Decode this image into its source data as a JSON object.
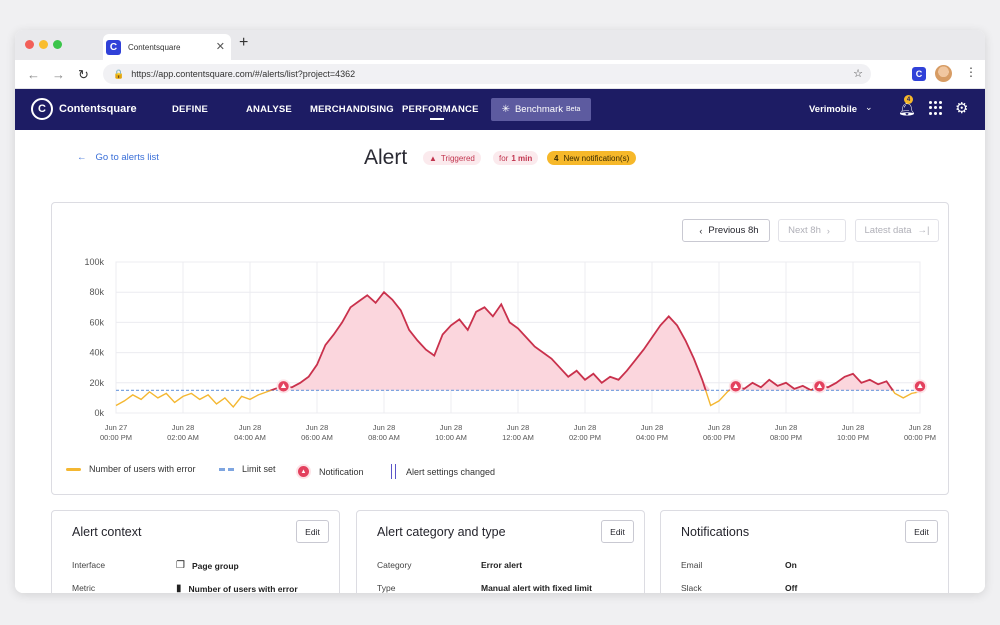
{
  "browser": {
    "tab_title": "Contentsquare",
    "tab_icon": "contentsquare-logo",
    "url": "https://app.contentsquare.com/#/alerts/list?project=4362"
  },
  "nav": {
    "logo": "Contentsquare",
    "items": [
      "DEFINE",
      "ANALYSE",
      "MERCHANDISING",
      "PERFORMANCE"
    ],
    "active": "PERFORMANCE",
    "benchmark_label": "Benchmark",
    "benchmark_badge": "Beta",
    "account": "Verimobile",
    "notification_count": "4"
  },
  "header": {
    "back_link": "Go to alerts list",
    "title": "Alert",
    "status": "Triggered",
    "duration_prefix": "for",
    "duration_value": "1 min",
    "notif_count": "4",
    "notif_label": "New notification(s)"
  },
  "chart_controls": {
    "previous": "Previous 8h",
    "next": "Next 8h",
    "latest": "Latest data"
  },
  "chart_data": {
    "type": "area",
    "title": "",
    "ylim": [
      0,
      100000
    ],
    "y_ticks": [
      {
        "value": 0,
        "label": "0k"
      },
      {
        "value": 20000,
        "label": "20k"
      },
      {
        "value": 40000,
        "label": "40k"
      },
      {
        "value": 60000,
        "label": "60k"
      },
      {
        "value": 80000,
        "label": "80k"
      },
      {
        "value": 100000,
        "label": "100k"
      }
    ],
    "x_range_hours": [
      0,
      24
    ],
    "x_ticks": [
      {
        "hour": 0,
        "date": "Jun 27",
        "time": "00:00 PM"
      },
      {
        "hour": 2,
        "date": "Jun 28",
        "time": "02:00 AM"
      },
      {
        "hour": 4,
        "date": "Jun 28",
        "time": "04:00 AM"
      },
      {
        "hour": 6,
        "date": "Jun 28",
        "time": "06:00 AM"
      },
      {
        "hour": 8,
        "date": "Jun 28",
        "time": "08:00 AM"
      },
      {
        "hour": 10,
        "date": "Jun 28",
        "time": "10:00 AM"
      },
      {
        "hour": 12,
        "date": "Jun 28",
        "time": "12:00 AM"
      },
      {
        "hour": 14,
        "date": "Jun 28",
        "time": "02:00 PM"
      },
      {
        "hour": 16,
        "date": "Jun 28",
        "time": "04:00 PM"
      },
      {
        "hour": 18,
        "date": "Jun 28",
        "time": "06:00 PM"
      },
      {
        "hour": 20,
        "date": "Jun 28",
        "time": "08:00 PM"
      },
      {
        "hour": 22,
        "date": "Jun 28",
        "time": "10:00 PM"
      },
      {
        "hour": 24,
        "date": "Jun 28",
        "time": "00:00 PM"
      }
    ],
    "limit": 15000,
    "series": [
      {
        "name": "Number of users with error",
        "points": [
          [
            0,
            5000
          ],
          [
            0.25,
            8000
          ],
          [
            0.5,
            12000
          ],
          [
            0.75,
            9000
          ],
          [
            1,
            14000
          ],
          [
            1.25,
            10000
          ],
          [
            1.5,
            13000
          ],
          [
            1.75,
            7000
          ],
          [
            2,
            11000
          ],
          [
            2.25,
            13000
          ],
          [
            2.5,
            9000
          ],
          [
            2.75,
            12000
          ],
          [
            3,
            6000
          ],
          [
            3.25,
            10000
          ],
          [
            3.5,
            4000
          ],
          [
            3.75,
            11000
          ],
          [
            4,
            9000
          ],
          [
            4.25,
            12000
          ],
          [
            4.5,
            14000
          ],
          [
            4.75,
            16000
          ],
          [
            5,
            18000
          ],
          [
            5.25,
            17000
          ],
          [
            5.5,
            20000
          ],
          [
            5.75,
            24000
          ],
          [
            6,
            32000
          ],
          [
            6.25,
            45000
          ],
          [
            6.5,
            52000
          ],
          [
            6.75,
            60000
          ],
          [
            7,
            70000
          ],
          [
            7.25,
            74000
          ],
          [
            7.5,
            78000
          ],
          [
            7.75,
            73000
          ],
          [
            8,
            80000
          ],
          [
            8.25,
            75000
          ],
          [
            8.5,
            68000
          ],
          [
            8.75,
            55000
          ],
          [
            9,
            48000
          ],
          [
            9.25,
            42000
          ],
          [
            9.5,
            38000
          ],
          [
            9.75,
            52000
          ],
          [
            10,
            58000
          ],
          [
            10.25,
            62000
          ],
          [
            10.5,
            55000
          ],
          [
            10.75,
            67000
          ],
          [
            11,
            70000
          ],
          [
            11.25,
            64000
          ],
          [
            11.5,
            72000
          ],
          [
            11.75,
            60000
          ],
          [
            12,
            56000
          ],
          [
            12.25,
            50000
          ],
          [
            12.5,
            44000
          ],
          [
            12.75,
            40000
          ],
          [
            13,
            36000
          ],
          [
            13.25,
            30000
          ],
          [
            13.5,
            24000
          ],
          [
            13.75,
            28000
          ],
          [
            14,
            22000
          ],
          [
            14.25,
            26000
          ],
          [
            14.5,
            20000
          ],
          [
            14.75,
            24000
          ],
          [
            15,
            22000
          ],
          [
            15.25,
            28000
          ],
          [
            15.5,
            35000
          ],
          [
            15.75,
            42000
          ],
          [
            16,
            50000
          ],
          [
            16.25,
            58000
          ],
          [
            16.5,
            64000
          ],
          [
            16.75,
            58000
          ],
          [
            17,
            48000
          ],
          [
            17.25,
            36000
          ],
          [
            17.5,
            22000
          ],
          [
            17.75,
            5000
          ],
          [
            18,
            8000
          ],
          [
            18.25,
            14000
          ],
          [
            18.5,
            18000
          ],
          [
            18.75,
            16000
          ],
          [
            19,
            20000
          ],
          [
            19.25,
            17000
          ],
          [
            19.5,
            22000
          ],
          [
            19.75,
            18000
          ],
          [
            20,
            20000
          ],
          [
            20.25,
            16000
          ],
          [
            20.5,
            18000
          ],
          [
            20.75,
            15000
          ],
          [
            21,
            19000
          ],
          [
            21.25,
            17000
          ],
          [
            21.5,
            20000
          ],
          [
            21.75,
            24000
          ],
          [
            22,
            26000
          ],
          [
            22.25,
            20000
          ],
          [
            22.5,
            22000
          ],
          [
            22.75,
            19000
          ],
          [
            23,
            21000
          ],
          [
            23.25,
            13000
          ],
          [
            23.5,
            10000
          ],
          [
            23.75,
            13000
          ],
          [
            24,
            14000
          ]
        ]
      }
    ],
    "notification_hours": [
      5,
      18.5,
      21,
      24
    ],
    "colors": {
      "line_below": "#f4b731",
      "line_above": "#c9314c",
      "fill_above": "#fbd6dd",
      "limit": "#7ea5e0",
      "notification": "#e3415e",
      "grid": "#ececf0"
    },
    "legend": [
      {
        "label": "Number of users with error",
        "swatch": "yellow-line"
      },
      {
        "label": "Limit set",
        "swatch": "dashed-line"
      },
      {
        "label": "Notification",
        "swatch": "notification-icon"
      },
      {
        "label": "Alert settings changed",
        "swatch": "double-bar"
      }
    ]
  },
  "cards": [
    {
      "title": "Alert context",
      "edit": "Edit",
      "rows": [
        {
          "key": "Interface",
          "value": "Page group",
          "icon": "page-group-icon"
        },
        {
          "key": "Metric",
          "value": "Number of users with error",
          "icon": "bar-chart-icon"
        }
      ]
    },
    {
      "title": "Alert category and type",
      "edit": "Edit",
      "rows": [
        {
          "key": "Category",
          "value": "Error alert"
        },
        {
          "key": "Type",
          "value": "Manual alert with fixed limit"
        }
      ]
    },
    {
      "title": "Notifications",
      "edit": "Edit",
      "rows": [
        {
          "key": "Email",
          "value": "On"
        },
        {
          "key": "Slack",
          "value": "Off"
        }
      ]
    }
  ]
}
